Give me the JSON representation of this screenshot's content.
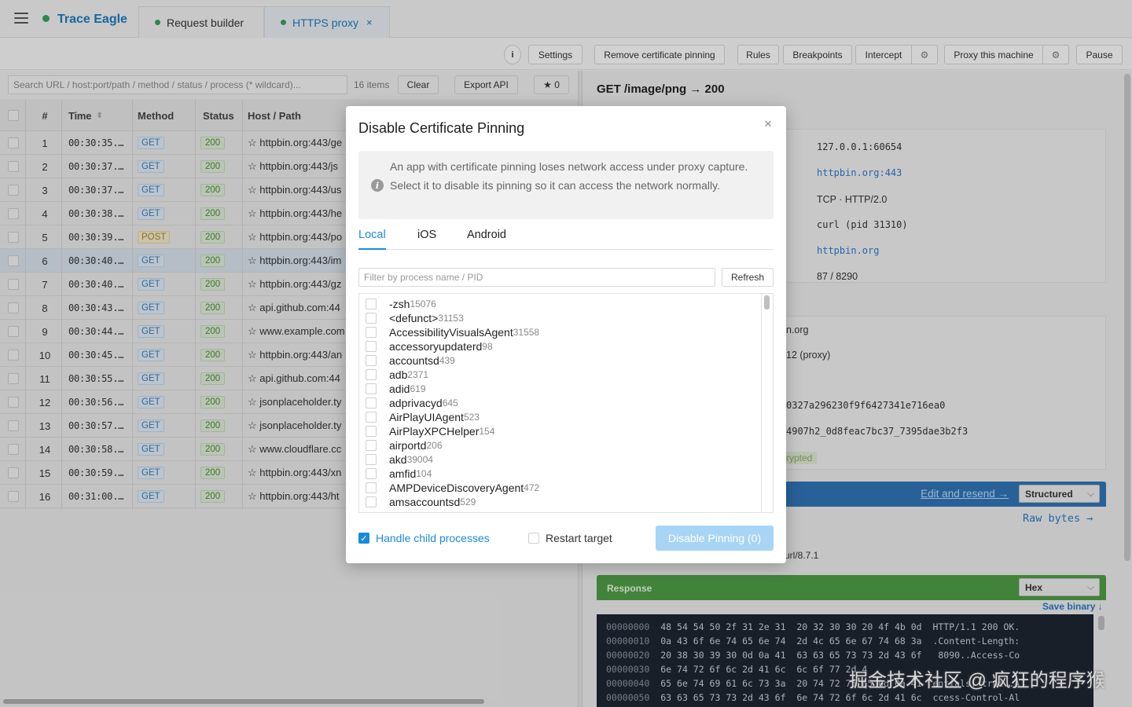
{
  "app": {
    "title": "Trace Eagle"
  },
  "tabs": [
    {
      "label": "Request builder"
    },
    {
      "label": "HTTPS proxy",
      "close": "×"
    }
  ],
  "toolbar": {
    "info": "i",
    "settings": "Settings",
    "remove_pinning": "Remove certificate pinning",
    "rules": "Rules",
    "breakpoints": "Breakpoints",
    "intercept": "Intercept",
    "proxy_machine": "Proxy this machine",
    "pause": "Pause"
  },
  "list": {
    "search_placeholder": "Search URL / host:port/path / method / status / process (* wildcard)...",
    "count": "16 items",
    "clear": "Clear",
    "export": "Export API",
    "starred": "★ 0",
    "headers": {
      "num": "#",
      "time": "Time",
      "method": "Method",
      "status": "Status",
      "host": "Host / Path"
    },
    "rows": [
      {
        "num": "1",
        "time": "00:30:35.…",
        "method": "GET",
        "status": "200",
        "host": "☆ httpbin.org:443/ge"
      },
      {
        "num": "2",
        "time": "00:30:37.…",
        "method": "GET",
        "status": "200",
        "host": "☆ httpbin.org:443/js"
      },
      {
        "num": "3",
        "time": "00:30:37.…",
        "method": "GET",
        "status": "200",
        "host": "☆ httpbin.org:443/us"
      },
      {
        "num": "4",
        "time": "00:30:38.…",
        "method": "GET",
        "status": "200",
        "host": "☆ httpbin.org:443/he"
      },
      {
        "num": "5",
        "time": "00:30:39.…",
        "method": "POST",
        "status": "200",
        "host": "☆ httpbin.org:443/po"
      },
      {
        "num": "6",
        "time": "00:30:40.…",
        "method": "GET",
        "status": "200",
        "host": "☆ httpbin.org:443/im"
      },
      {
        "num": "7",
        "time": "00:30:40.…",
        "method": "GET",
        "status": "200",
        "host": "☆ httpbin.org:443/gz"
      },
      {
        "num": "8",
        "time": "00:30:43.…",
        "method": "GET",
        "status": "200",
        "host": "☆ api.github.com:44"
      },
      {
        "num": "9",
        "time": "00:30:44.…",
        "method": "GET",
        "status": "200",
        "host": "☆ www.example.com"
      },
      {
        "num": "10",
        "time": "00:30:45.…",
        "method": "GET",
        "status": "200",
        "host": "☆ httpbin.org:443/an"
      },
      {
        "num": "11",
        "time": "00:30:55.…",
        "method": "GET",
        "status": "200",
        "host": "☆ api.github.com:44"
      },
      {
        "num": "12",
        "time": "00:30:56.…",
        "method": "GET",
        "status": "200",
        "host": "☆ jsonplaceholder.ty"
      },
      {
        "num": "13",
        "time": "00:30:57.…",
        "method": "GET",
        "status": "200",
        "host": "☆ jsonplaceholder.ty"
      },
      {
        "num": "14",
        "time": "00:30:58.…",
        "method": "GET",
        "status": "200",
        "host": "☆ www.cloudflare.cc"
      },
      {
        "num": "15",
        "time": "00:30:59.…",
        "method": "GET",
        "status": "200",
        "host": "☆ httpbin.org:443/xn"
      },
      {
        "num": "16",
        "time": "00:31:00.…",
        "method": "GET",
        "status": "200",
        "host": "☆ httpbin.org:443/ht"
      }
    ]
  },
  "detail": {
    "title": "GET /image/png → 200",
    "conn": [
      "127.0.0.1:60654",
      "httpbin.org:443",
      "TCP · HTTP/2.0",
      "curl (pid 31310)",
      "httpbin.org",
      "87 / 8290"
    ],
    "tls": [
      "n.org",
      "12 (proxy)",
      "0327a296230f9f6427341e716ea0",
      "4907h2_0d8feac7bc37_7395dae3b2f3",
      "rypted"
    ],
    "edit_resend": "Edit and resend →",
    "structured": "Structured",
    "raw_bytes": "Raw bytes →",
    "ua": "url/8.7.1",
    "response_label": "Response",
    "hex_mode": "Hex",
    "save_binary": "Save binary ↓",
    "hex_rows": [
      {
        "off": "00000000",
        "bytes": "48 54 54 50 2f 31 2e 31  20 32 30 30 20 4f 4b 0d",
        "ascii": "HTTP/1.1 200 OK."
      },
      {
        "off": "00000010",
        "bytes": "0a 43 6f 6e 74 65 6e 74  2d 4c 65 6e 67 74 68 3a",
        "ascii": ".Content-Length:"
      },
      {
        "off": "00000020",
        "bytes": "20 38 30 39 30 0d 0a 41  63 63 65 73 73 2d 43 6f",
        "ascii": " 8090..Access-Co"
      },
      {
        "off": "00000030",
        "bytes": "6e 74 72 6f 6c 2d 41 6c  6c 6f 77 2d 4",
        "ascii": ""
      },
      {
        "off": "00000040",
        "bytes": "65 6e 74 69 61 6c 73 3a  20 74 72 75 65 0d 0a 41",
        "ascii": "entials: true..A"
      },
      {
        "off": "00000050",
        "bytes": "63 63 65 73 73 2d 43 6f  6e 74 72 6f 6c 2d 41 6c",
        "ascii": "ccess-Control-Al"
      }
    ],
    "watermark": "掘金技术社区 @ 疯狂的程序猴"
  },
  "modal": {
    "title": "Disable Certificate Pinning",
    "close": "×",
    "notice_icon": "i",
    "notice": "An app with certificate pinning loses network access under proxy capture. Select it to disable its pinning so it can access the network normally.",
    "tabs": [
      "Local",
      "iOS",
      "Android"
    ],
    "filter_placeholder": "Filter by process name / PID",
    "refresh": "Refresh",
    "processes": [
      {
        "name": "-zsh",
        "pid": "15076"
      },
      {
        "name": "<defunct>",
        "pid": "31153"
      },
      {
        "name": "AccessibilityVisualsAgent",
        "pid": "31558"
      },
      {
        "name": "accessoryupdaterd",
        "pid": "98"
      },
      {
        "name": "accountsd",
        "pid": "439"
      },
      {
        "name": "adb",
        "pid": "2371"
      },
      {
        "name": "adid",
        "pid": "619"
      },
      {
        "name": "adprivacyd",
        "pid": "645"
      },
      {
        "name": "AirPlayUIAgent",
        "pid": "523"
      },
      {
        "name": "AirPlayXPCHelper",
        "pid": "154"
      },
      {
        "name": "airportd",
        "pid": "206"
      },
      {
        "name": "akd",
        "pid": "39004"
      },
      {
        "name": "amfid",
        "pid": "104"
      },
      {
        "name": "AMPDeviceDiscoveryAgent",
        "pid": "472"
      },
      {
        "name": "amsaccountsd",
        "pid": "529"
      }
    ],
    "handle_child": "Handle child processes",
    "restart_target": "Restart target",
    "disable_button": "Disable Pinning (0)"
  }
}
